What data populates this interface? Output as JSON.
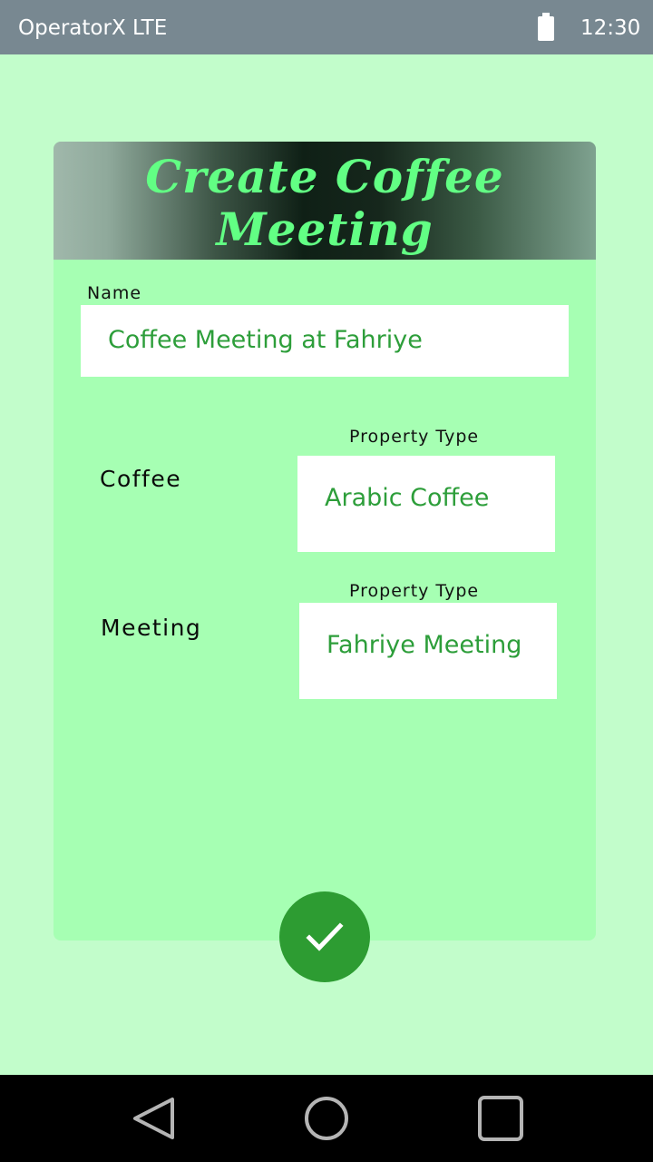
{
  "status_bar": {
    "carrier": "OperatorX LTE",
    "time": "12:30"
  },
  "card": {
    "title_line1": "Create Coffee",
    "title_line2": "Meeting",
    "name_label": "Name",
    "name_value": "Coffee Meeting at Fahriye",
    "rows": [
      {
        "label": "Coffee",
        "field_label": "Property Type",
        "value": "Arabic Coffee"
      },
      {
        "label": "Meeting",
        "field_label": "Property Type",
        "value": "Fahriye Meeting"
      }
    ]
  },
  "icons": {
    "battery": "battery-icon",
    "confirm": "checkmark-icon",
    "back": "back-triangle-icon",
    "home": "home-circle-icon",
    "recents": "recents-square-icon"
  },
  "colors": {
    "background": "#c2fdcb",
    "card": "#a6ffb3",
    "title": "#62ff84",
    "value_text": "#2d9e3a",
    "fab": "#2d9c32",
    "status_bar": "#788891"
  }
}
